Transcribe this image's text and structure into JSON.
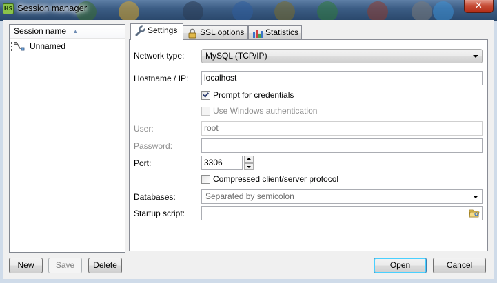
{
  "window": {
    "title": "Session manager",
    "app_icon_text": "HS",
    "close_label": "✕"
  },
  "session_list": {
    "header": "Session name",
    "sort_indicator": "▲",
    "items": [
      {
        "label": "Unnamed",
        "icon": "network-plug-icon"
      }
    ]
  },
  "tabs": [
    {
      "label": "Settings",
      "icon": "wrench-icon",
      "active": true
    },
    {
      "label": "SSL options",
      "icon": "lock-icon",
      "active": false
    },
    {
      "label": "Statistics",
      "icon": "bar-chart-icon",
      "active": false
    }
  ],
  "settings": {
    "network_type": {
      "label": "Network type:",
      "value": "MySQL (TCP/IP)"
    },
    "hostname": {
      "label": "Hostname / IP:",
      "value": "localhost"
    },
    "prompt_credentials": {
      "label": "Prompt for credentials",
      "checked": true
    },
    "windows_auth": {
      "label": "Use Windows authentication",
      "checked": false,
      "enabled": false
    },
    "user": {
      "label": "User:",
      "value": "root"
    },
    "password": {
      "label": "Password:",
      "value": ""
    },
    "port": {
      "label": "Port:",
      "value": "3306"
    },
    "compressed": {
      "label": "Compressed client/server protocol",
      "checked": false
    },
    "databases": {
      "label": "Databases:",
      "value": "Separated by semicolon"
    },
    "startup_script": {
      "label": "Startup script:",
      "value": ""
    }
  },
  "buttons": {
    "new": "New",
    "save": "Save",
    "delete": "Delete",
    "open": "Open",
    "cancel": "Cancel"
  },
  "colors": {
    "titlebar": "#3c5d85",
    "close_button": "#c64c36",
    "default_button_border": "#3c7fb1"
  }
}
